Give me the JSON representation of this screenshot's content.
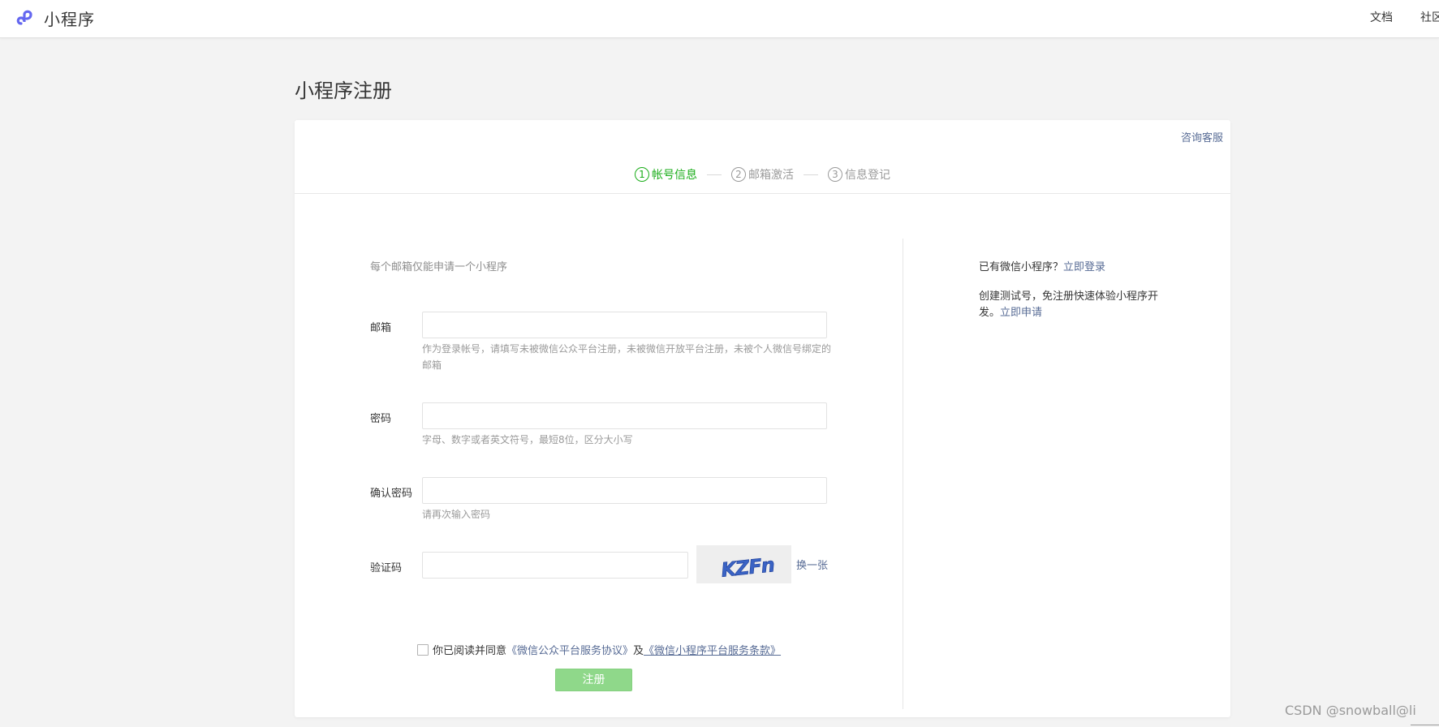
{
  "header": {
    "logo_text": "小程序",
    "nav": {
      "docs": "文档",
      "community": "社区"
    }
  },
  "page_title": "小程序注册",
  "consult_link": "咨询客服",
  "steps": [
    {
      "num": "1",
      "label": "帐号信息",
      "active": true
    },
    {
      "num": "2",
      "label": "邮箱激活",
      "active": false
    },
    {
      "num": "3",
      "label": "信息登记",
      "active": false
    }
  ],
  "form": {
    "tip": "每个邮箱仅能申请一个小程序",
    "email": {
      "label": "邮箱",
      "value": "",
      "hint": "作为登录帐号，请填写未被微信公众平台注册，未被微信开放平台注册，未被个人微信号绑定的邮箱"
    },
    "password": {
      "label": "密码",
      "value": "",
      "hint": "字母、数字或者英文符号，最短8位，区分大小写"
    },
    "confirm_password": {
      "label": "确认密码",
      "value": "",
      "hint": "请再次输入密码"
    },
    "captcha": {
      "label": "验证码",
      "value": "",
      "image_text": "KZFn",
      "refresh": "换一张"
    },
    "agreement": {
      "checked": false,
      "prefix": "你已阅读并同意",
      "link1": "《微信公众平台服务协议》",
      "conj": "及",
      "link2": "《微信小程序平台服务条款》"
    },
    "submit": "注册"
  },
  "side": {
    "login_prefix": "已有微信小程序？",
    "login_link": "立即登录",
    "test_text": "创建测试号，免注册快速体验小程序开发。",
    "test_link": "立即申请"
  },
  "watermark": "CSDN @snowball@li",
  "colors": {
    "accent_green": "#1aad19",
    "link_blue": "#576b95",
    "button_disabled": "#8fd88a",
    "logo_purple": "#6467f0"
  }
}
